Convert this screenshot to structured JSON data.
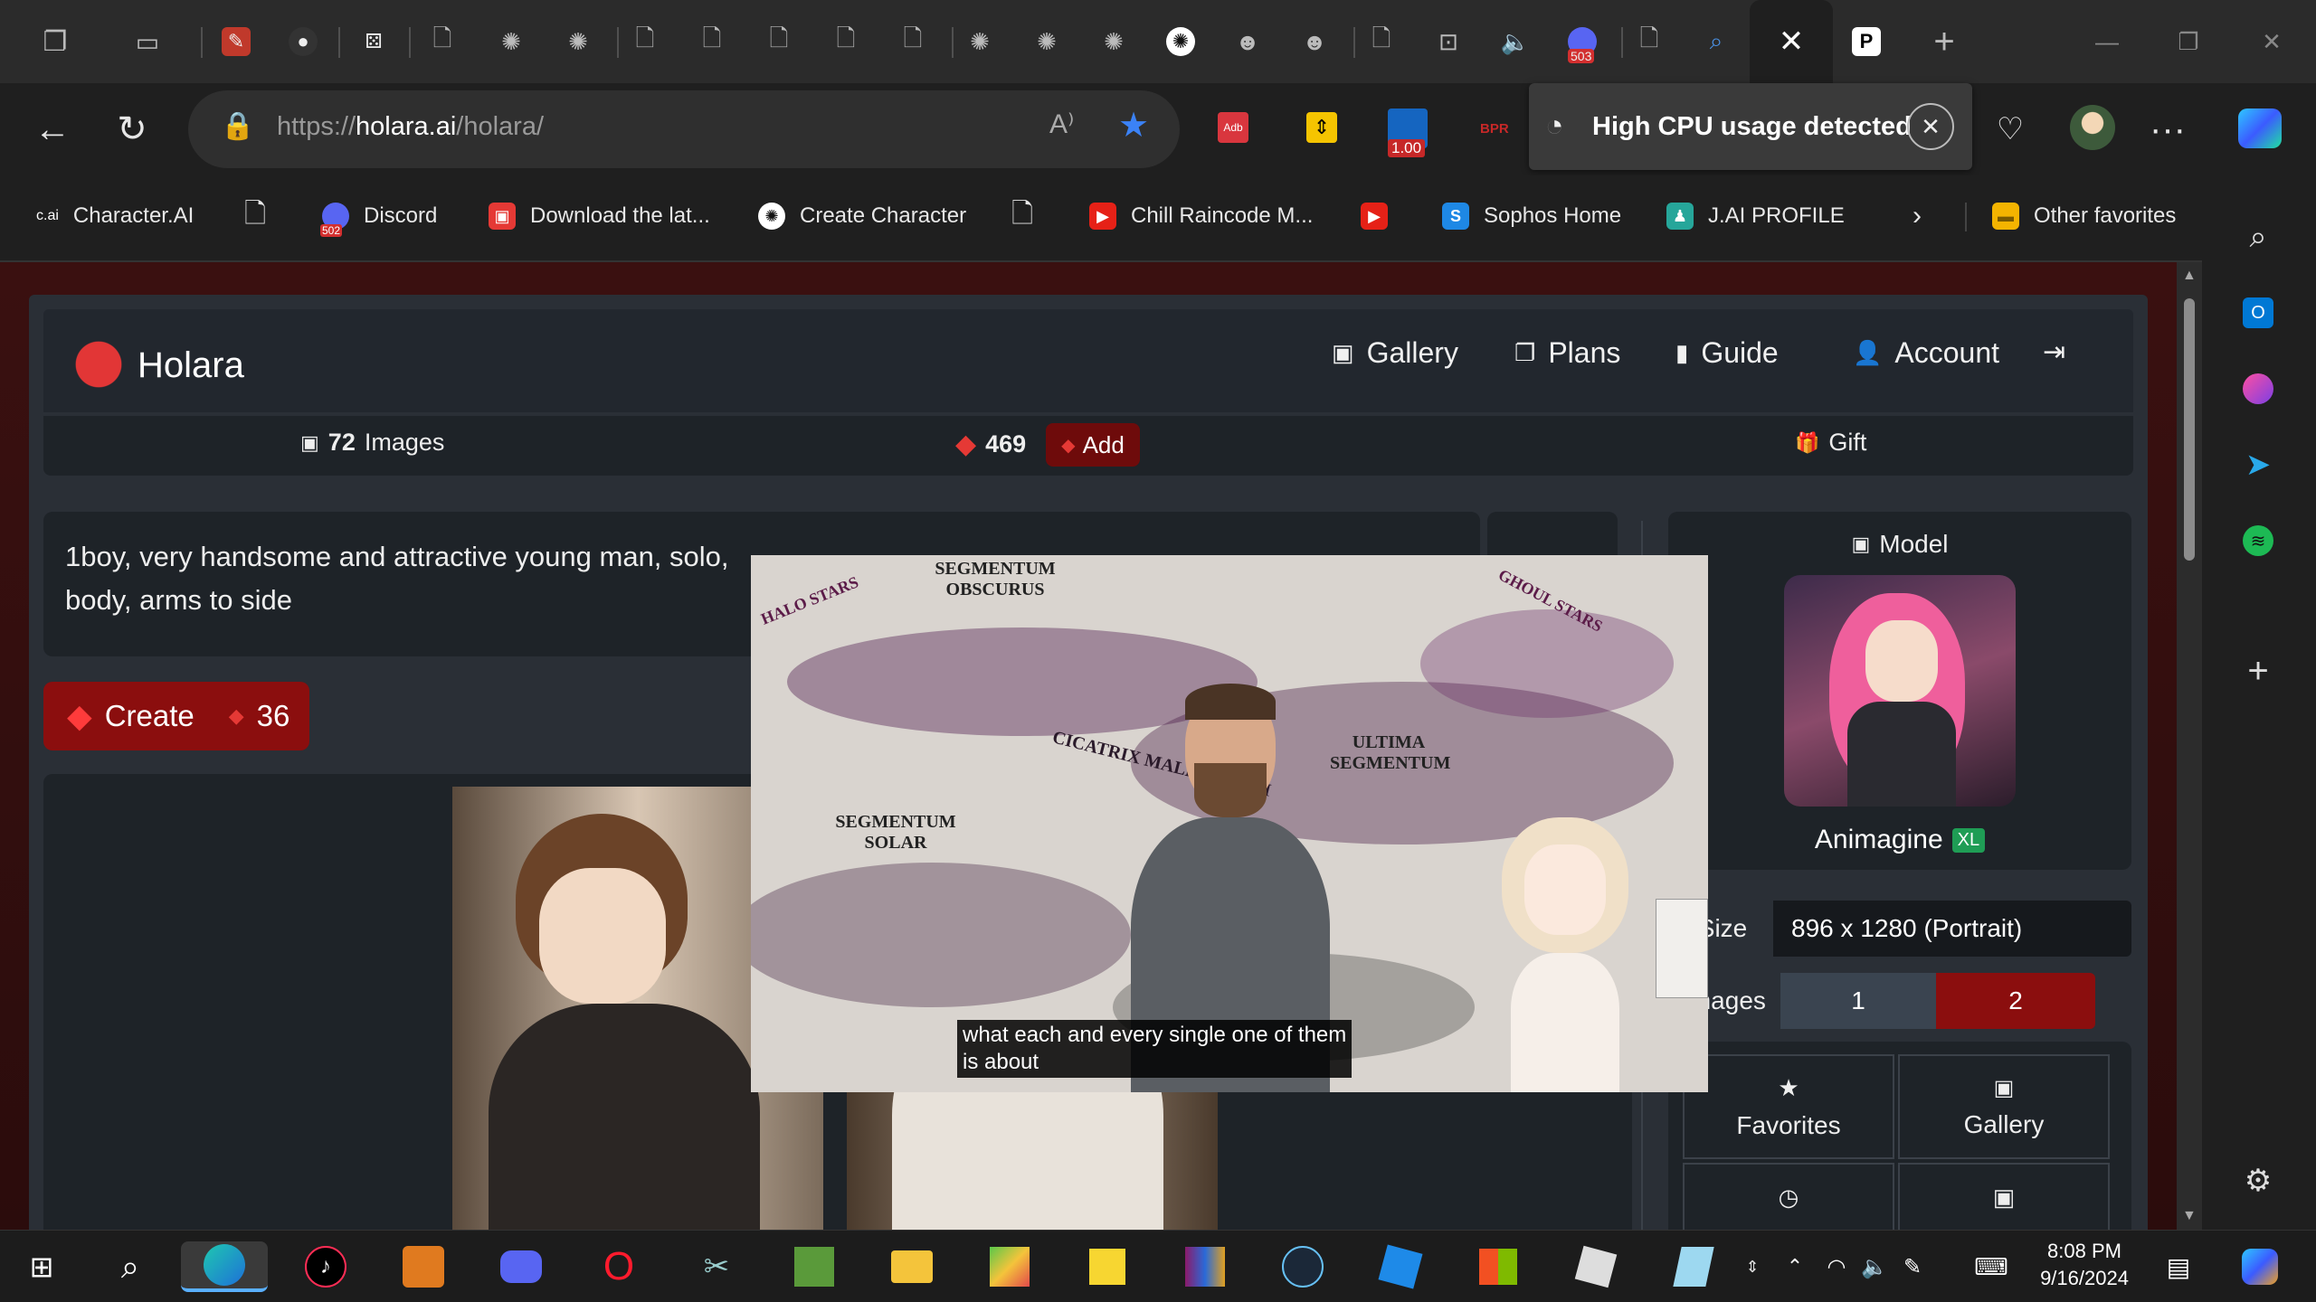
{
  "browser": {
    "url_prefix": "https://",
    "url_host": "holara.ai",
    "url_path": "/holara/",
    "notification": "High CPU usage detected",
    "ext_badge": "1.00",
    "tab_badge_503": "503"
  },
  "favorites": [
    {
      "label": "Character.AI",
      "icon": "c.ai"
    },
    {
      "label": "",
      "icon": "page-icon"
    },
    {
      "label": "Discord",
      "icon": "502"
    },
    {
      "label": "Download the lat...",
      "icon": "download-icon"
    },
    {
      "label": "Create Character",
      "icon": "openai-icon"
    },
    {
      "label": "",
      "icon": "page-icon"
    },
    {
      "label": "Chill Raincode M...",
      "icon": "youtube-icon"
    },
    {
      "label": "",
      "icon": "youtube-icon"
    },
    {
      "label": "Sophos Home",
      "icon": "S"
    },
    {
      "label": "J.AI PROFILE",
      "icon": "janitor-icon"
    },
    {
      "label": "Other favorites",
      "icon": "folder-icon"
    }
  ],
  "app": {
    "brand": "Holara",
    "nav": [
      "Gallery",
      "Plans",
      "Guide",
      "Account"
    ],
    "images_count": "72",
    "images_label": "Images",
    "gems": "469",
    "add_label": "Add",
    "gift_label": "Gift",
    "prompt": "1boy, very handsome and attractive young man, solo,",
    "prompt_line2": "body, arms to side",
    "create_label": "Create",
    "create_cost": "36",
    "model_header": "Model",
    "model_name": "Animagine",
    "model_badge": "XL",
    "size_label": "Size",
    "size_value": "896 x 1280 (Portrait)",
    "images_field_label": "Images",
    "images_options": [
      "1",
      "2"
    ],
    "favorites_label": "Favorites",
    "gallery_label": "Gallery"
  },
  "video": {
    "subtitle_line1": "what each and every single one of them",
    "subtitle_line2": "is about",
    "map_labels": [
      "SEGMENTUM OBSCURUS",
      "HALO STARS",
      "GHOUL STARS",
      "ULTIMA SEGMENTUM",
      "SEGMENTUM SOLAR",
      "CICATRIX MALEDICTUM"
    ]
  },
  "taskbar": {
    "time": "8:08 PM",
    "date": "9/16/2024"
  },
  "colors": {
    "accent_red": "#8b0e0e",
    "edge_star": "#3b82f6",
    "xl_badge": "#1f9d55"
  }
}
